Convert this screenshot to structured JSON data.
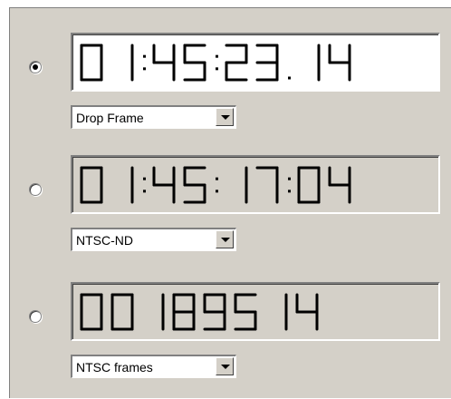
{
  "timecode_formats": [
    {
      "selected": true,
      "display_text": "01:45:23.14",
      "display_background": "#ffffff",
      "format_label": "Drop Frame"
    },
    {
      "selected": false,
      "display_text": "01:45:17:04",
      "display_background": "#d4d0c8",
      "format_label": "NTSC-ND"
    },
    {
      "selected": false,
      "display_text": "00189514",
      "display_background": "#d4d0c8",
      "format_label": "NTSC frames"
    }
  ],
  "icons": {
    "radio": "radio-button-icon",
    "dropdown": "chevron-down-icon"
  }
}
